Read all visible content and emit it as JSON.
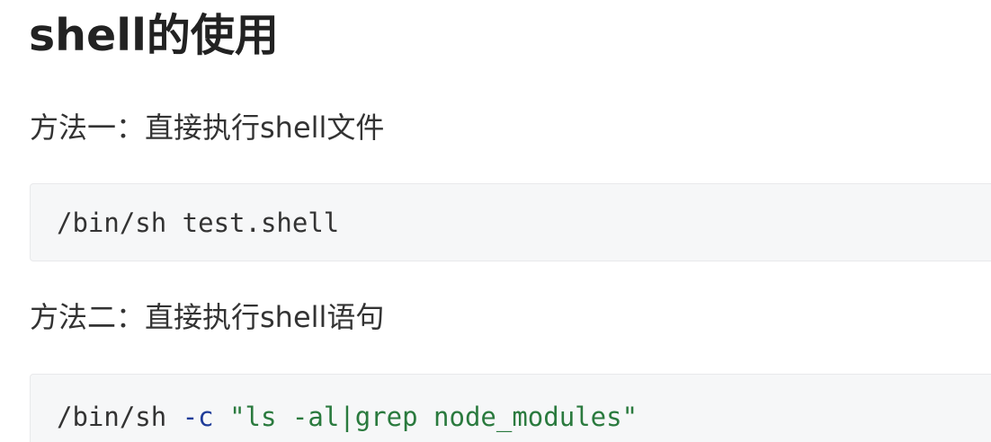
{
  "article": {
    "title": "shell的使用",
    "method_one": {
      "heading": "方法一：直接执行shell文件",
      "code": "/bin/sh test.shell"
    },
    "method_two": {
      "heading": "方法二：直接执行shell语句",
      "code_command": "/bin/sh ",
      "code_flag": "-c",
      "code_space": " ",
      "code_string": "\"ls -al|grep node_modules\""
    }
  },
  "colors": {
    "code_background": "#f6f7f8",
    "code_flag": "#1f3c99",
    "code_string": "#2a7a3e",
    "text": "#333333"
  }
}
